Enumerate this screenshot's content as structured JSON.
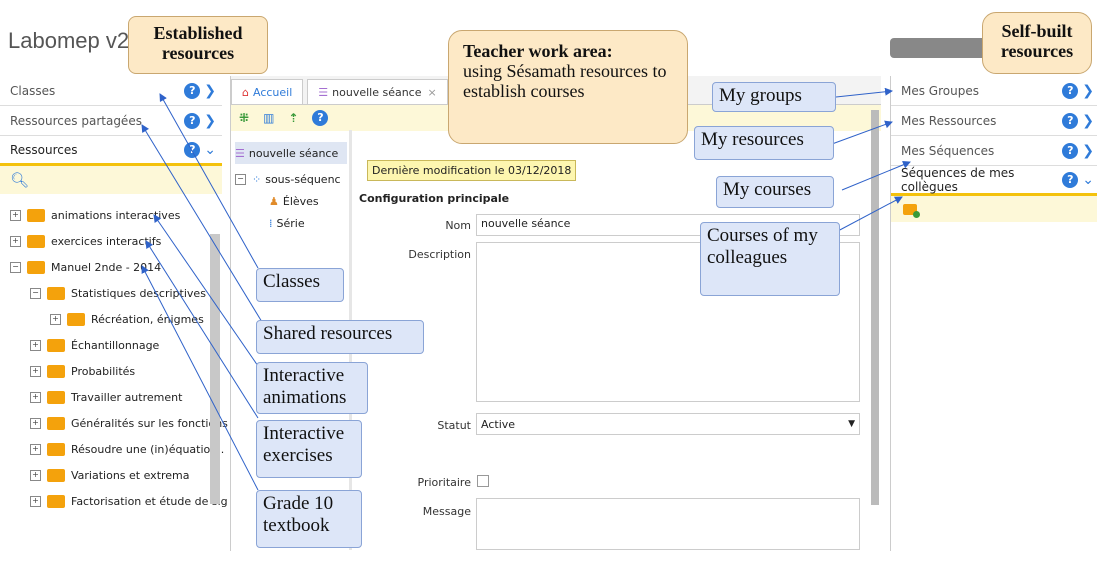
{
  "app": {
    "title": "Labomep v2"
  },
  "left": {
    "rows": [
      {
        "label": "Classes"
      },
      {
        "label": "Ressources partagées"
      },
      {
        "label": "Ressources"
      }
    ],
    "tree": [
      {
        "label": "animations interactives",
        "level": 0,
        "sign": "+"
      },
      {
        "label": "exercices interactifs",
        "level": 0,
        "sign": "+"
      },
      {
        "label": "Manuel 2nde - 2014",
        "level": 0,
        "sign": "−"
      },
      {
        "label": "Statistiques descriptives",
        "level": 1,
        "sign": "−"
      },
      {
        "label": "Récréation, énigmes",
        "level": 2,
        "sign": "+"
      },
      {
        "label": "Échantillonnage",
        "level": 1,
        "sign": "+"
      },
      {
        "label": "Probabilités",
        "level": 1,
        "sign": "+"
      },
      {
        "label": "Travailler autrement",
        "level": 1,
        "sign": "+"
      },
      {
        "label": "Généralités sur les fonctions",
        "level": 1,
        "sign": "+"
      },
      {
        "label": "Résoudre une (in)équation .",
        "level": 1,
        "sign": "+"
      },
      {
        "label": "Variations et extrema",
        "level": 1,
        "sign": "+"
      },
      {
        "label": "Factorisation et étude de sig",
        "level": 1,
        "sign": "+"
      }
    ]
  },
  "middle": {
    "tabs": [
      {
        "label": "Accueil"
      },
      {
        "label": "nouvelle séance"
      }
    ],
    "tree": {
      "root": "nouvelle séance",
      "sub": "sous-séquenc",
      "eleves": "Élèves",
      "serie": "Série"
    },
    "tooltip": "Dernière modification le 03/12/2018",
    "section_title": "Configuration principale",
    "form": {
      "nom_label": "Nom",
      "nom_value": "nouvelle séance",
      "description_label": "Description",
      "statut_label": "Statut",
      "statut_value": "Active",
      "prioritaire_label": "Prioritaire",
      "message_label": "Message"
    }
  },
  "right": {
    "rows": [
      {
        "label": "Mes Groupes"
      },
      {
        "label": "Mes Ressources"
      },
      {
        "label": "Mes Séquences"
      },
      {
        "label": "Séquences de mes collègues"
      }
    ]
  },
  "callouts": {
    "established": "Established resources",
    "teacher_work_area_title": "Teacher work area:",
    "teacher_work_area_body": "using Sésamath resources to establish courses",
    "self_built": "Self-built resources",
    "my_groups": "My groups",
    "my_resources": "My resources",
    "my_courses": "My courses",
    "colleagues": "Courses of my colleagues",
    "classes": "Classes",
    "shared": "Shared resources",
    "animations": "Interactive animations",
    "exercises": "Interactive exercises",
    "textbook": "Grade 10 textbook"
  },
  "colors": {
    "accent": "#2f7bd9",
    "folder": "#f4a20c",
    "callout": "#dde6f8",
    "heading_callout": "#fde9c6"
  }
}
